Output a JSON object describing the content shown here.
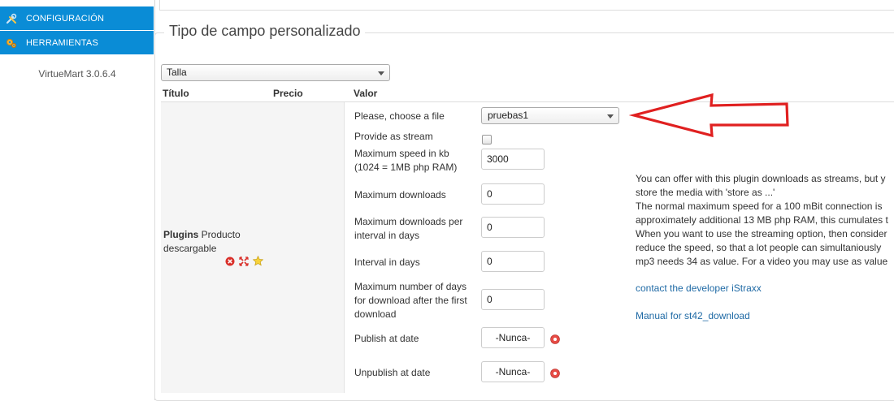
{
  "sidebar": {
    "items": [
      {
        "label": "CONFIGURACIÓN",
        "icon": "wrench-screwdriver-icon"
      },
      {
        "label": "HERRAMIENTAS",
        "icon": "gears-icon"
      }
    ],
    "version": "VirtueMart 3.0.6.4"
  },
  "section": {
    "legend": "Tipo de campo personalizado",
    "type_select_value": "Talla"
  },
  "columns": {
    "titulo": "Título",
    "precio": "Precio",
    "valor": "Valor"
  },
  "plugin": {
    "bold_label": "Plugins",
    "rest_label": " Producto descargable",
    "icons": [
      "remove-icon",
      "move-icon",
      "star-icon"
    ]
  },
  "fields": {
    "choose_file": {
      "label": "Please, choose a file",
      "value": "pruebas1"
    },
    "stream": {
      "label": "Provide as stream",
      "checked": false
    },
    "max_speed": {
      "label": "Maximum speed in kb (1024 = 1MB php RAM)",
      "value": "3000"
    },
    "max_downloads": {
      "label": "Maximum downloads",
      "value": "0"
    },
    "max_downloads_interval": {
      "label": "Maximum downloads per interval in days",
      "value": "0"
    },
    "interval_days": {
      "label": "Interval in days",
      "value": "0"
    },
    "max_days": {
      "label": "Maximum number of days for download after the first download",
      "value": "0"
    },
    "publish": {
      "label": "Publish at date",
      "value": "-Nunca-"
    },
    "unpublish": {
      "label": "Unpublish at date",
      "value": "-Nunca-"
    }
  },
  "info": {
    "lines": [
      "You can offer with this plugin downloads as streams, but y",
      "store the media with 'store as ...'",
      "The normal maximum speed for a 100 mBit connection is",
      "approximately additional 13 MB php RAM, this cumulates t",
      "When you want to use the streaming option, then consider",
      "reduce the speed, so that a lot people can simultaniously",
      "mp3 needs 34 as value. For a video you may use as value"
    ],
    "link1": "contact the developer iStraxx",
    "link2": "Manual for st42_download"
  },
  "colors": {
    "accent": "#0a8cd6",
    "arrow": "#e02020",
    "link": "#1f6aa5"
  }
}
